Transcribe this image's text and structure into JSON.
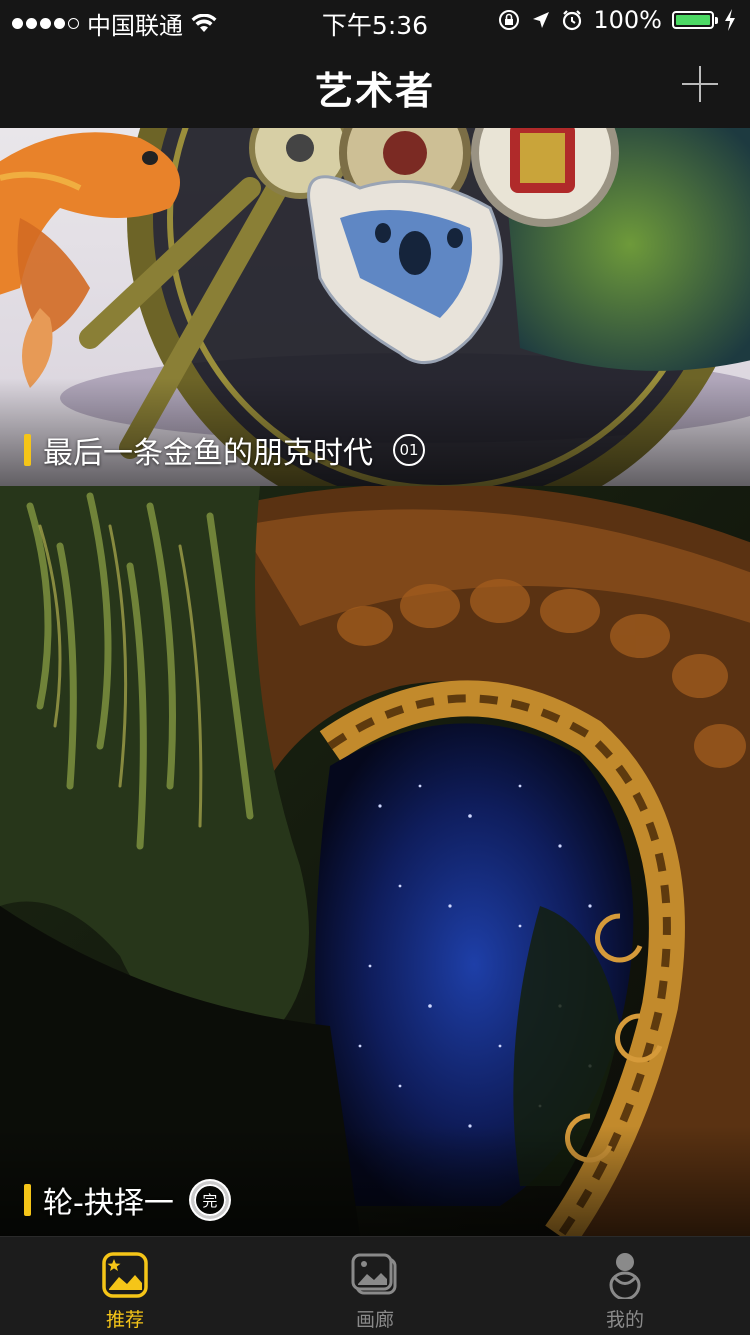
{
  "status_bar": {
    "carrier": "中国联通",
    "time": "下午5:36",
    "battery": "100%",
    "battery_level": 1.0,
    "signal_bars_filled": 4,
    "signal_bars_total": 5
  },
  "nav": {
    "title": "艺术者",
    "add_icon": "plus-icon"
  },
  "feed": {
    "items": [
      {
        "title": "最后一条金鱼的朋克时代",
        "badge": "01"
      },
      {
        "title": "轮-抉择一",
        "badge": "完"
      }
    ]
  },
  "tabbar": {
    "tabs": [
      {
        "label": "推荐",
        "icon": "recommend-icon",
        "active": true
      },
      {
        "label": "画廊",
        "icon": "gallery-icon",
        "active": false
      },
      {
        "label": "我的",
        "icon": "profile-icon",
        "active": false
      }
    ]
  },
  "colors": {
    "accent": "#f5c518",
    "background": "#161616",
    "tab_inactive": "#8a8a8a",
    "battery": "#4cd964"
  }
}
